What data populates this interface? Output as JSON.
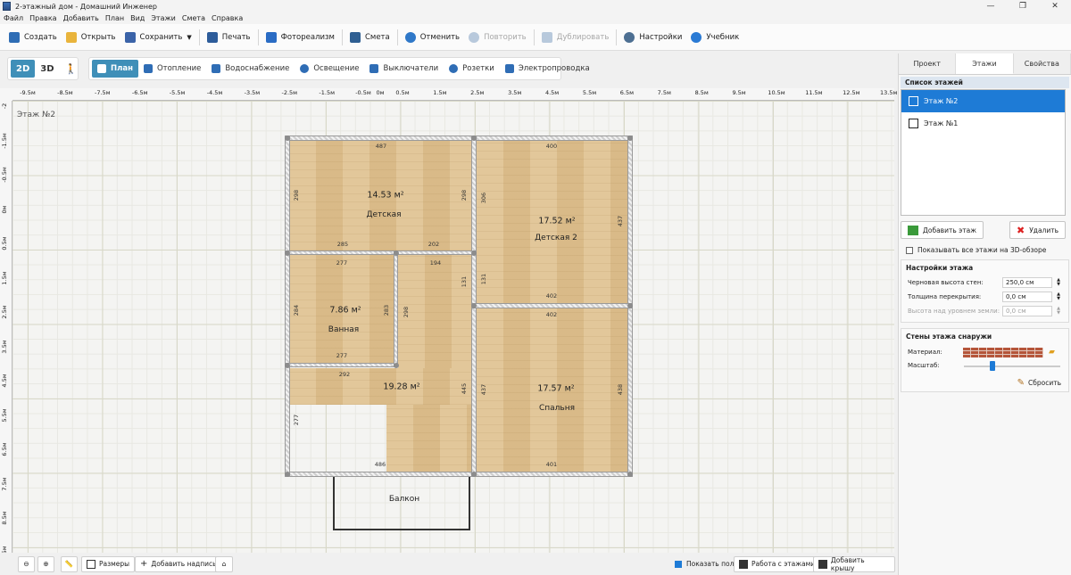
{
  "window": {
    "title": "2-этажный дом - Домашний Инженер"
  },
  "menu": [
    "Файл",
    "Правка",
    "Добавить",
    "План",
    "Вид",
    "Этажи",
    "Смета",
    "Справка"
  ],
  "toolbar": {
    "create": "Создать",
    "open": "Открыть",
    "save": "Сохранить",
    "print": "Печать",
    "photoreal": "Фотореализм",
    "estimate": "Смета",
    "undo": "Отменить",
    "redo": "Повторить",
    "duplicate": "Дублировать",
    "settings": "Настройки",
    "tutorial": "Учебник"
  },
  "view_modes": {
    "two_d": "2D",
    "three_d": "3D"
  },
  "plan_tabs": {
    "plan": "План",
    "heating": "Отопление",
    "water": "Водоснабжение",
    "lighting": "Освещение",
    "switches": "Выключатели",
    "sockets": "Розетки",
    "wiring": "Электропроводка"
  },
  "ruler": {
    "x_ticks": [
      "-9.5м",
      "-8.5м",
      "-7.5м",
      "-6.5м",
      "-5.5м",
      "-4.5м",
      "-3.5м",
      "-2.5м",
      "-1.5м",
      "-0.5м",
      "0м",
      "0.5м",
      "1.5м",
      "2.5м",
      "3.5м",
      "4.5м",
      "5.5м",
      "6.5м",
      "7.5м",
      "8.5м",
      "9.5м",
      "10.5м",
      "11.5м",
      "12.5м",
      "13.5м"
    ],
    "y_ticks": [
      "-2",
      "-1.5м",
      "-0.5м",
      "0м",
      "0.5м",
      "1.5м",
      "2.5м",
      "3.5м",
      "4.5м",
      "5.5м",
      "6.5м",
      "7.5м",
      "8.5м",
      "9.5м"
    ]
  },
  "canvas": {
    "floor_label": "Этаж №2",
    "rooms": {
      "kids1": {
        "name": "Детская",
        "area": "14.53 м²"
      },
      "kids2": {
        "name": "Детская 2",
        "area": "17.52 м²"
      },
      "bath": {
        "name": "Ванная",
        "area": "7.86 м²"
      },
      "hall": {
        "area": "19.28 м²"
      },
      "bedroom": {
        "name": "Спальня",
        "area": "17.57 м²"
      },
      "balcony": {
        "name": "Балкон"
      }
    },
    "dims": {
      "d487": "487",
      "d400": "400",
      "d285": "285",
      "d202": "202",
      "d298a": "298",
      "d298b": "298",
      "d306": "306",
      "d437a": "437",
      "d277a": "277",
      "d194": "194",
      "d131a": "131",
      "d131b": "131",
      "d402a": "402",
      "d402b": "402",
      "d284": "284",
      "d283": "283",
      "d298c": "298",
      "d277b": "277",
      "d292": "292",
      "d445": "445",
      "d437b": "437",
      "d438": "438",
      "d277c": "277",
      "d486": "486",
      "d401": "401"
    }
  },
  "bottom": {
    "sizes": "Размеры",
    "add_label": "Добавить надпись",
    "show_floor": "Показать пол",
    "floors_work": "Работа с этажами",
    "add_roof": "Добавить крышу"
  },
  "panel": {
    "tabs": [
      "Проект",
      "Этажи",
      "Свойства"
    ],
    "list_title": "Список этажей",
    "floors": [
      "Этаж №2",
      "Этаж №1"
    ],
    "add_floor": "Добавить этаж",
    "delete": "Удалить",
    "show_all": "Показывать все этажи на 3D-обзоре",
    "floor_settings": "Настройки этажа",
    "wall_height_label": "Черновая высота стен:",
    "wall_height": "250,0 см",
    "slab_label": "Толщина перекрытия:",
    "slab": "0,0 см",
    "ground_label": "Высота над уровнем земли:",
    "ground": "0,0 см",
    "outer_walls": "Стены этажа снаружи",
    "material_label": "Материал:",
    "scale_label": "Масштаб:",
    "scale_value": 0.28,
    "reset": "Сбросить"
  }
}
